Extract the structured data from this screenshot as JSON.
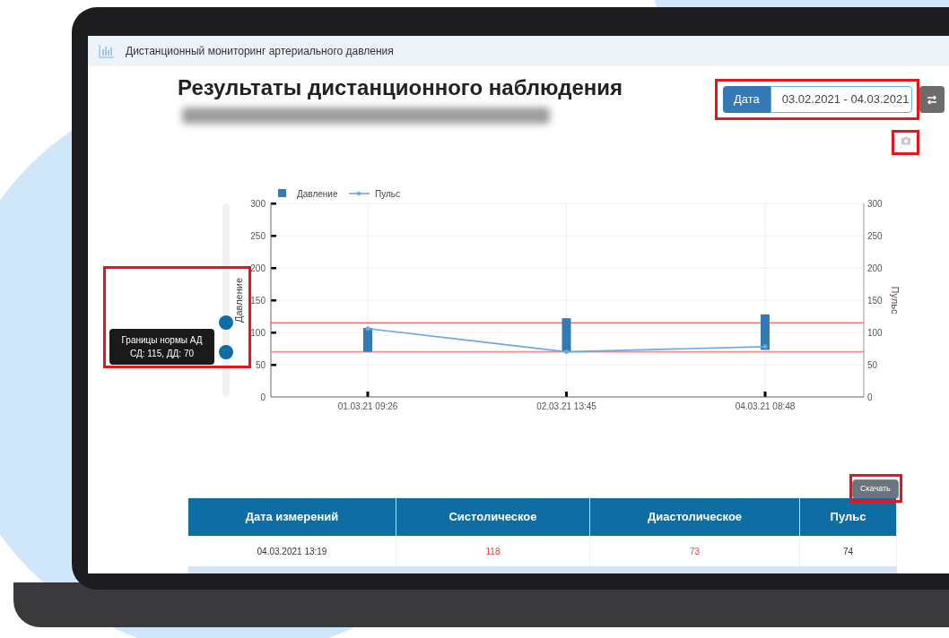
{
  "app_bar": {
    "title": "Дистанционный мониторинг артериального давления"
  },
  "page_title": "Результаты дистанционного наблюдения",
  "date_filter": {
    "label": "Дата",
    "value": "03.02.2021 - 04.03.2021"
  },
  "norm_slider": {
    "tooltip_title": "Границы нормы АД",
    "tooltip_text": "СД: 115, ДД: 70",
    "upper": {
      "level": 0.383
    },
    "lower": {
      "level": 0.233
    }
  },
  "chart_data": {
    "type": "bar",
    "ylabel": "Давление",
    "y2label": "Пульс",
    "categories": [
      "01.03.21 09:26",
      "02.03.21 13:45",
      "04.03.21 08:48"
    ],
    "series": [
      {
        "name": "Давление",
        "type": "candlestick",
        "color": "#337ab7",
        "ohlc": [
          [
            70,
            107,
            70,
            107
          ],
          [
            70,
            122,
            70,
            122
          ],
          [
            73,
            128,
            73,
            128
          ]
        ]
      },
      {
        "name": "Пульс",
        "type": "line",
        "color": "#6fa8dc",
        "values": [
          106,
          70,
          78
        ]
      }
    ],
    "grid": true,
    "ylim": [
      0,
      300
    ],
    "yticks": [
      0,
      50,
      100,
      150,
      200,
      250,
      300
    ],
    "y2lim": [
      0,
      300
    ],
    "y2ticks": [
      0,
      50,
      100,
      150,
      200,
      250,
      300
    ],
    "legend": true,
    "ref_lines": [
      {
        "axis": "y",
        "value": 115,
        "color": "#ff2a2a"
      },
      {
        "axis": "y",
        "value": 70,
        "color": "#ff8a8a"
      }
    ]
  },
  "download_button": "Скачать",
  "table": {
    "columns": [
      "Дата измерений",
      "Систолическое",
      "Диастолическое",
      "Пульс"
    ],
    "rows": [
      {
        "cells": [
          {
            "text": "04.03.2021 13:19",
            "alert": false
          },
          {
            "text": "118",
            "alert": true
          },
          {
            "text": "73",
            "alert": true
          },
          {
            "text": "74",
            "alert": false
          }
        ]
      }
    ]
  }
}
